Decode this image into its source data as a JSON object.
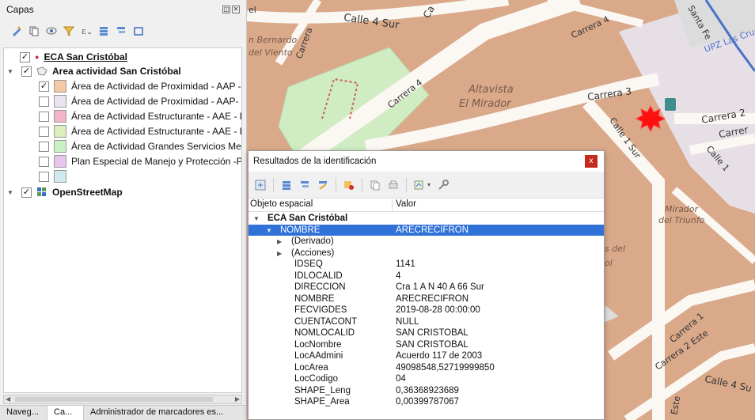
{
  "layers_panel": {
    "title": "Capas",
    "float_icons": [
      "restore-icon",
      "close-icon"
    ],
    "toolbar_icons": [
      "style-icon",
      "add-group-icon",
      "visibility-icon",
      "filter-icon",
      "expression-filter-icon",
      "expand-all-icon",
      "collapse-all-icon",
      "remove-layer-icon"
    ],
    "layers": [
      {
        "label": "ECA San Cristóbal",
        "checked": "✓",
        "bold": true,
        "underline": true
      },
      {
        "label": "Area actividad San Cristóbal",
        "checked": "✓",
        "bold": true
      },
      {
        "label": "Área de Actividad de Proximidad - AAP - F",
        "checked": "✓",
        "color": "#f4c9a3"
      },
      {
        "label": "Área de Actividad de Proximidad - AAP- G",
        "checked": "",
        "color": "#eae3f2"
      },
      {
        "label": "Área de Actividad Estructurante - AAE - Re",
        "checked": "",
        "color": "#f2b5c8"
      },
      {
        "label": "Área de Actividad Estructurante - AAE - Re",
        "checked": "",
        "color": "#dbeebe"
      },
      {
        "label": "Área de Actividad Grandes Servicios Metro",
        "checked": "",
        "color": "#c9f1c6"
      },
      {
        "label": "Plan Especial de Manejo y Protección -PEN",
        "checked": "",
        "color": "#e9c5ec"
      },
      {
        "label": "",
        "checked": "",
        "color": "#cfe9ee"
      },
      {
        "label": "OpenStreetMap",
        "checked": "✓",
        "bold": true
      }
    ],
    "tabs": [
      "Naveg...",
      "Ca...",
      "Administrador de marcadores es..."
    ]
  },
  "map": {
    "labels": [
      "el",
      "Calle 4 Sur",
      "Ca",
      "n Bernardo",
      "Carrera",
      "del Viento",
      "Carrera 4",
      "Altavista",
      "El Mirador",
      "Carrera 4",
      "Carrera 3",
      "Santa Fe",
      "UPZ Las Cruc",
      "Calle 1 Sur",
      "Carrera 2",
      "Carrer",
      "Calle 1",
      "Mirador",
      "del Triunfo",
      "s del",
      "ol",
      "Carrera 1",
      "Carrera 2 Este",
      "Calle 4 Su",
      "Este"
    ]
  },
  "identify": {
    "title": "Resultados de la identificación",
    "close_label": "x",
    "toolbar_icons": [
      "expand-tree-icon",
      "collapse-tree-icon",
      "expand-new-icon",
      "clear-results-icon",
      "highlight-icon",
      "copy-icon",
      "print-icon",
      "view-mode-icon",
      "settings-icon"
    ],
    "columns": [
      "Objeto espacial",
      "Valor"
    ],
    "layer_name": "ECA San Cristóbal",
    "feature": {
      "field": "NOMBRE",
      "value": "ARECRECIFRON"
    },
    "groups": [
      "(Derivado)",
      "(Acciones)"
    ],
    "attributes": [
      {
        "field": "IDSEQ",
        "value": "1141"
      },
      {
        "field": "IDLOCALID",
        "value": "4"
      },
      {
        "field": "DIRECCION",
        "value": "Cra 1 A N 40 A 66 Sur"
      },
      {
        "field": "NOMBRE",
        "value": "ARECRECIFRON"
      },
      {
        "field": "FECVIGDES",
        "value": "2019-08-28 00:00:00"
      },
      {
        "field": "CUENTACONT",
        "value": "NULL"
      },
      {
        "field": "NOMLOCALID",
        "value": "SAN CRISTOBAL"
      },
      {
        "field": "LocNombre",
        "value": "SAN CRISTOBAL"
      },
      {
        "field": "LocAAdmini",
        "value": "Acuerdo 117 de 2003"
      },
      {
        "field": "LocArea",
        "value": "49098548,52719999850"
      },
      {
        "field": "LocCodigo",
        "value": "04"
      },
      {
        "field": "SHAPE_Leng",
        "value": "0,36368923689"
      },
      {
        "field": "SHAPE_Area",
        "value": "0,00399787067"
      }
    ]
  }
}
